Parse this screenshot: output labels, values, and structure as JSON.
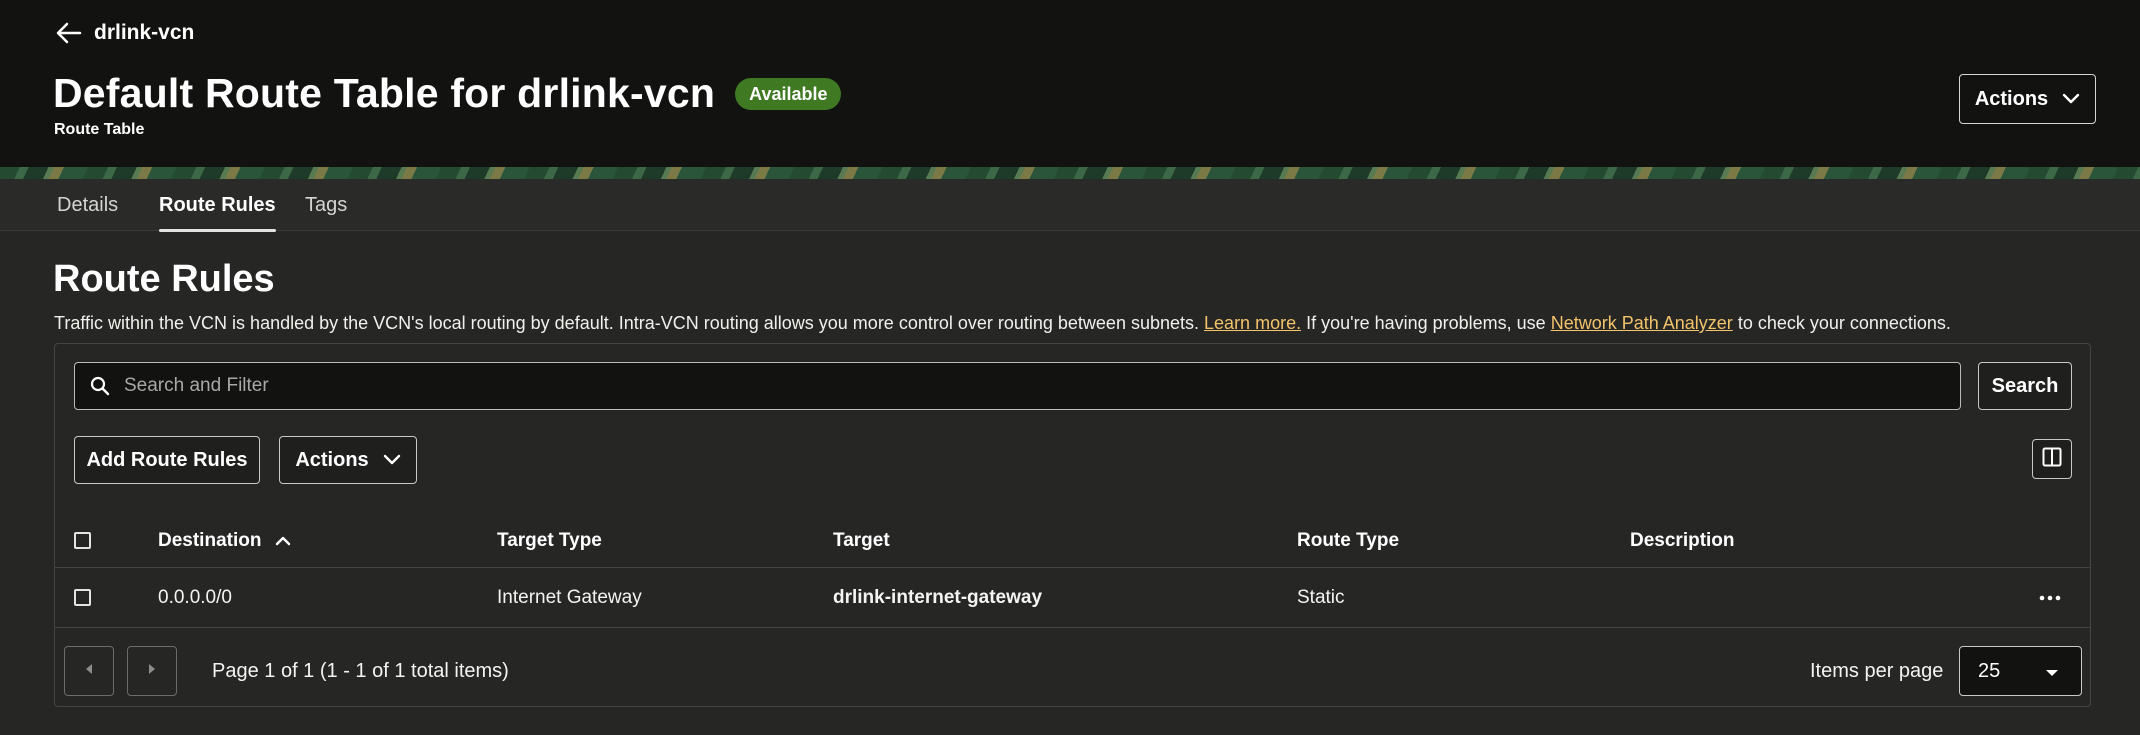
{
  "header": {
    "back_label": "drlink-vcn",
    "title": "Default Route Table for drlink-vcn",
    "status": "Available",
    "subtitle": "Route Table",
    "actions_label": "Actions"
  },
  "tabs": [
    {
      "label": "Details",
      "active": false
    },
    {
      "label": "Route Rules",
      "active": true
    },
    {
      "label": "Tags",
      "active": false
    }
  ],
  "section": {
    "title": "Route Rules",
    "description_1": "Traffic within the VCN is handled by the VCN's local routing by default. Intra-VCN routing allows you more control over routing between subnets.",
    "learn_more": "Learn more.",
    "description_2": "If you're having problems, use",
    "analyzer_link": "Network Path Analyzer",
    "description_3": "to check your connections."
  },
  "toolbar": {
    "search_placeholder": "Search and Filter",
    "search_label": "Search",
    "add_label": "Add Route Rules",
    "actions_label": "Actions"
  },
  "table": {
    "columns": [
      "Destination",
      "Target Type",
      "Target",
      "Route Type",
      "Description"
    ],
    "sort_column": "Destination",
    "sort_direction": "ascending",
    "rows": [
      {
        "destination": "0.0.0.0/0",
        "target_type": "Internet Gateway",
        "target": "drlink-internet-gateway",
        "route_type": "Static",
        "description": ""
      }
    ]
  },
  "pagination": {
    "page_info": "Page 1 of 1 (1 - 1 of 1 total items)",
    "items_per_page_label": "Items per page",
    "items_per_page": "25"
  },
  "colors": {
    "header_bg": "#121211",
    "body_bg": "#262625",
    "status_green": "#3f7a23",
    "link": "#f2c36b"
  }
}
